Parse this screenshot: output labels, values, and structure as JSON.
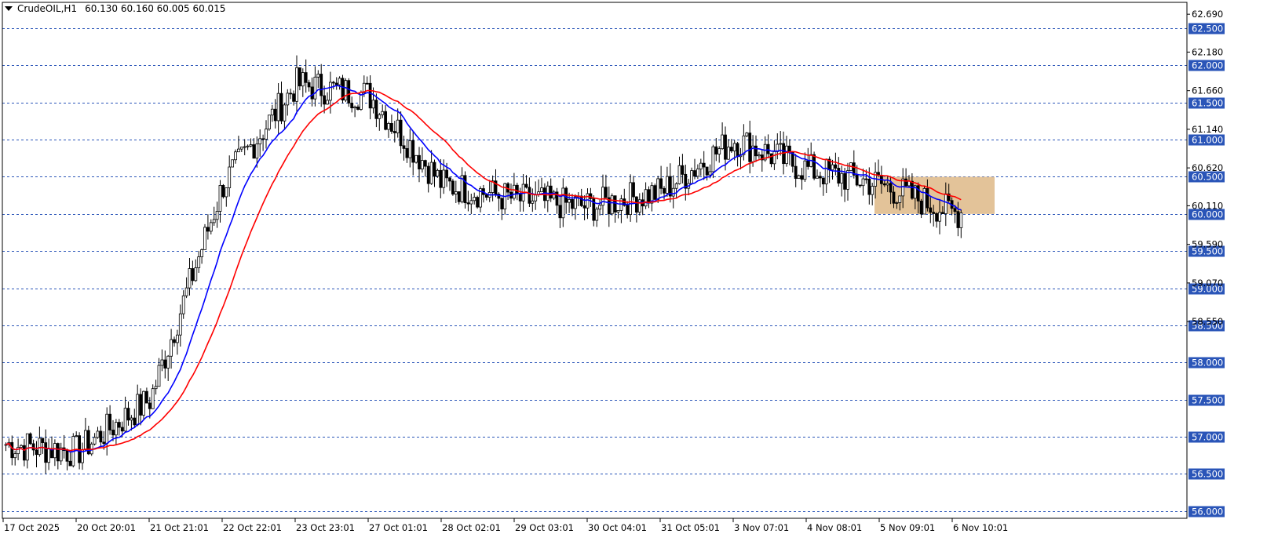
{
  "header": {
    "symbol": "CrudeOIL,H1",
    "ohlc": "60.130 60.160 60.005 60.015"
  },
  "price_axis": {
    "labels": [
      "62.690",
      "62.180",
      "61.660",
      "61.140",
      "60.620",
      "60.110",
      "59.590",
      "59.070",
      "58.550"
    ],
    "level_badges": [
      "62.500",
      "62.000",
      "61.500",
      "61.000",
      "60.500",
      "60.000",
      "59.500",
      "59.000",
      "58.500",
      "58.000",
      "57.500",
      "57.000",
      "56.500",
      "56.000"
    ]
  },
  "time_axis": {
    "labels": [
      "17 Oct 2025",
      "20 Oct 20:01",
      "21 Oct 21:01",
      "22 Oct 22:01",
      "23 Oct 23:01",
      "27 Oct 01:01",
      "28 Oct 02:01",
      "29 Oct 03:01",
      "30 Oct 04:01",
      "31 Oct 05:01",
      "3 Nov 07:01",
      "4 Nov 08:01",
      "5 Nov 09:01",
      "6 Nov 10:01"
    ]
  },
  "colors": {
    "background": "#ffffff",
    "grid_dash": "#2a55b8",
    "badge_bg": "#2a55b8",
    "candle": "#000000",
    "ma_fast": "#0000ff",
    "ma_slow": "#ff0000",
    "zone_fill": "#deb887"
  },
  "chart_data": {
    "type": "candlestick",
    "symbol": "CrudeOIL",
    "timeframe": "H1",
    "y_range": [
      55.9,
      62.85
    ],
    "anchors": [
      {
        "date": "17 Oct 2025",
        "price": 56.9
      },
      {
        "date": "20 Oct 20:01",
        "price": 56.8
      },
      {
        "date": "21 Oct 21:01",
        "price": 57.5
      },
      {
        "date": "22 Oct 22:01",
        "price": 60.4
      },
      {
        "date": "23 Oct 23:01",
        "price": 61.75
      },
      {
        "date": "27 Oct 01:01",
        "price": 61.6
      },
      {
        "date": "28 Oct 02:01",
        "price": 60.4
      },
      {
        "date": "29 Oct 03:01",
        "price": 60.2
      },
      {
        "date": "30 Oct 04:01",
        "price": 60.1
      },
      {
        "date": "31 Oct 05:01",
        "price": 60.3
      },
      {
        "date": "3 Nov 07:01",
        "price": 61.0
      },
      {
        "date": "4 Nov 08:01",
        "price": 60.6
      },
      {
        "date": "5 Nov 09:01",
        "price": 60.4
      },
      {
        "date": "6 Nov 10:01",
        "price": 60.015
      }
    ],
    "extremes": {
      "low": 55.95,
      "high": 62.55
    },
    "last_bar": {
      "open": 60.13,
      "high": 60.16,
      "low": 60.005,
      "close": 60.015
    },
    "series": [
      {
        "values_note": "",
        "kind": "moving-average",
        "color": "#0000ff"
      },
      {
        "values_note": "",
        "kind": "moving-average",
        "color": "#ff0000"
      }
    ],
    "zone": {
      "price_from": 60.0,
      "price_to": 60.5,
      "start": "5 Nov 09:01",
      "end": "6 Nov 10:01"
    },
    "grid": true
  }
}
